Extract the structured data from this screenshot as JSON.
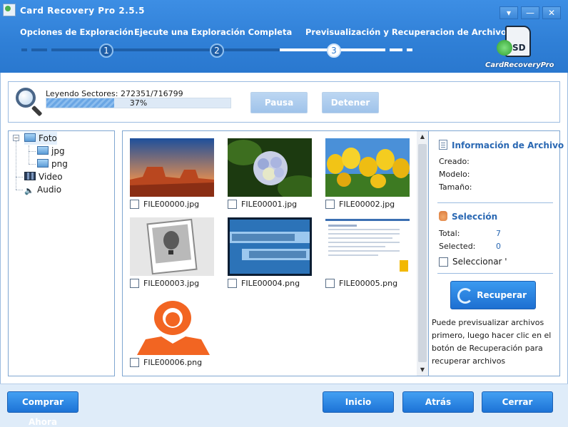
{
  "window": {
    "title": "Card Recovery Pro 2.5.5",
    "controls": [
      "▾",
      "—",
      "✕"
    ]
  },
  "steps": {
    "items": [
      {
        "number": "1",
        "label": "Opciones de Exploración"
      },
      {
        "number": "2",
        "label": "Ejecute una Exploración Completa"
      },
      {
        "number": "3",
        "label": "Previsualización y Recuperacion de Archivos"
      }
    ],
    "current": 3
  },
  "brand": {
    "card_text": "SD",
    "name": "CardRecoveryPro"
  },
  "scan": {
    "read_label": "Leyendo Sectores: 272351/716799",
    "progress_text": "37%",
    "progress": 0.37,
    "pause_label": "Pausa",
    "stop_label": "Detener"
  },
  "tree": {
    "items": [
      {
        "label": "Foto",
        "icon": "photo-icon",
        "level": 0
      },
      {
        "label": "jpg",
        "icon": "photo-icon",
        "level": 1
      },
      {
        "label": "png",
        "icon": "photo-icon",
        "level": 1
      },
      {
        "label": "Video",
        "icon": "video-icon",
        "level": 0
      },
      {
        "label": "Audio",
        "icon": "audio-icon",
        "level": 0
      }
    ],
    "expander": "−"
  },
  "files": [
    {
      "name": "FILE00000.jpg",
      "thumb": "desert-mesa"
    },
    {
      "name": "FILE00001.jpg",
      "thumb": "hydrangea-flower"
    },
    {
      "name": "FILE00002.jpg",
      "thumb": "yellow-tulips"
    },
    {
      "name": "FILE00003.jpg",
      "thumb": "balloon-photo-icon"
    },
    {
      "name": "FILE00004.png",
      "thumb": "american-express-logo"
    },
    {
      "name": "FILE00005.png",
      "thumb": "web-page-screenshot"
    },
    {
      "name": "FILE00006.png",
      "thumb": "orange-lion-logo"
    }
  ],
  "info": {
    "file_info_title": "Información de Archivo",
    "created_label": "Creado:",
    "model_label": "Modelo:",
    "size_label": "Tamaño:",
    "selection_title": "Selección",
    "total_label": "Total:",
    "total_value": "7",
    "selected_label": "Selected:",
    "selected_value": "0",
    "select_all_label": "Seleccionar '",
    "recover_label": "Recuperar",
    "note": "Puede previsualizar archivos primero, luego hacer clic en el botón de Recuperación para recuperar archivos"
  },
  "footer": {
    "buy_label": "Comprar Ahora",
    "home_label": "Inicio",
    "back_label": "Atrás",
    "close_label": "Cerrar"
  },
  "colors": {
    "header": "#2f7fd6",
    "accent": "#2a68b3",
    "button": "#1d73d6"
  }
}
